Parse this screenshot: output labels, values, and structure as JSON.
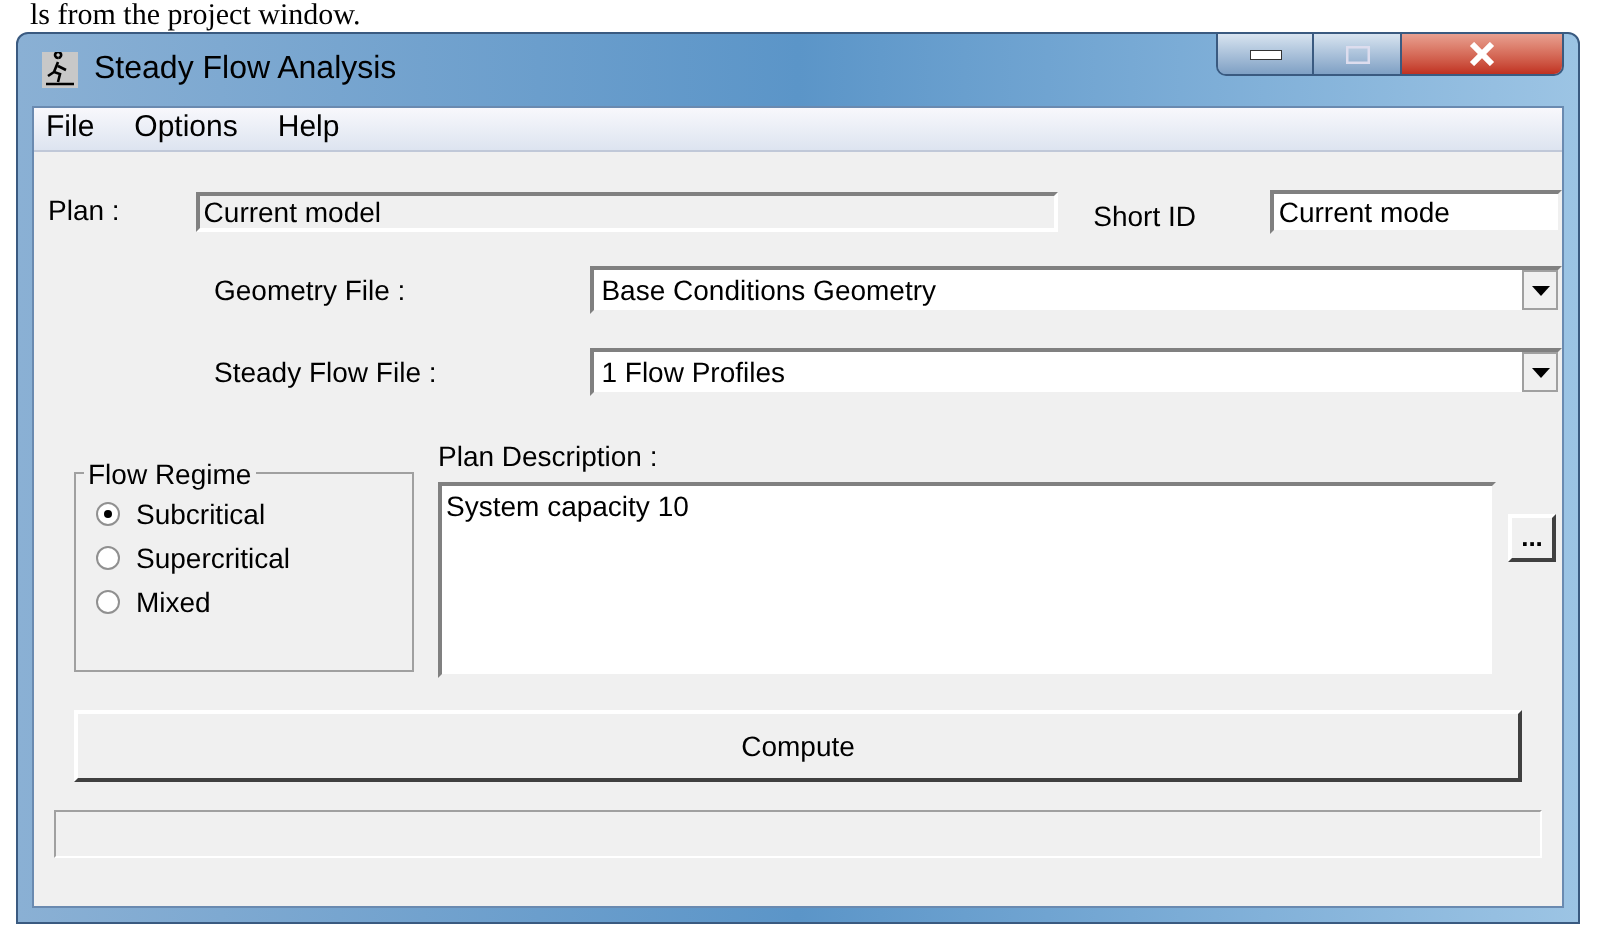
{
  "caption": "ls from the project window.",
  "window": {
    "title": "Steady Flow Analysis"
  },
  "menu": [
    "File",
    "Options",
    "Help"
  ],
  "plan": {
    "label": "Plan :",
    "value": "Current model"
  },
  "short_id": {
    "label": "Short ID",
    "value": "Current mode"
  },
  "geometry_file": {
    "label": "Geometry File :",
    "value": "Base Conditions Geometry"
  },
  "steady_flow_file": {
    "label": "Steady Flow File :",
    "value": "1 Flow Profiles"
  },
  "flow_regime": {
    "title": "Flow Regime",
    "options": [
      {
        "label": "Subcritical",
        "selected": true
      },
      {
        "label": "Supercritical",
        "selected": false
      },
      {
        "label": "Mixed",
        "selected": false
      }
    ]
  },
  "plan_description": {
    "label": "Plan Description :",
    "value": "System capacity 10",
    "button": "..."
  },
  "compute_button": "Compute"
}
